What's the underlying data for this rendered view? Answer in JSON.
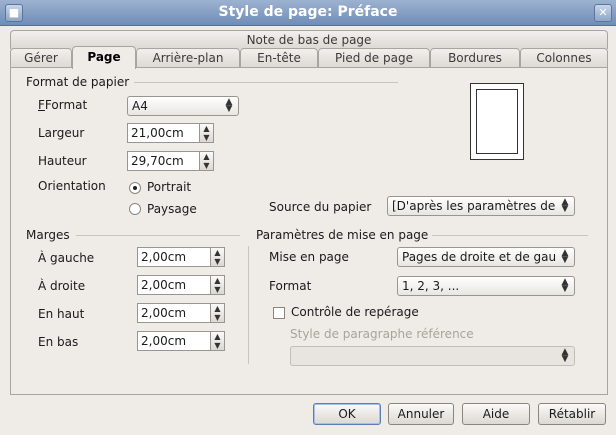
{
  "window": {
    "title": "Style de page: Préface"
  },
  "tabs_top": [
    "Note de bas de page"
  ],
  "tabs": [
    "Gérer",
    "Page",
    "Arrière-plan",
    "En-tête",
    "Pied de page",
    "Bordures",
    "Colonnes"
  ],
  "paper_format": {
    "section_title": "Format de papier",
    "format_label": "Format",
    "format_value": "A4",
    "width_label": "Largeur",
    "width_value": "21,00cm",
    "height_label": "Hauteur",
    "height_value": "29,70cm",
    "orientation_label": "Orientation",
    "portrait_label": "Portrait",
    "landscape_label": "Paysage",
    "orientation_selected": "Portrait",
    "source_label": "Source du papier",
    "source_value": "[D'après les paramètres de"
  },
  "margins": {
    "section_title": "Marges",
    "left_label": "À gauche",
    "left_value": "2,00cm",
    "right_label": "À droite",
    "right_value": "2,00cm",
    "top_label": "En haut",
    "top_value": "2,00cm",
    "bottom_label": "En bas",
    "bottom_value": "2,00cm"
  },
  "layout": {
    "section_title": "Paramètres de mise en page",
    "layout_label": "Mise en page",
    "layout_value": "Pages de droite et de gau",
    "format_label": "Format",
    "format_value": "1, 2, 3, ...",
    "register_label": "Contrôle de repérage",
    "ref_style_label": "Style de paragraphe référence",
    "ref_style_value": ""
  },
  "buttons": {
    "ok": "OK",
    "cancel": "Annuler",
    "help": "Aide",
    "reset": "Rétablir"
  }
}
